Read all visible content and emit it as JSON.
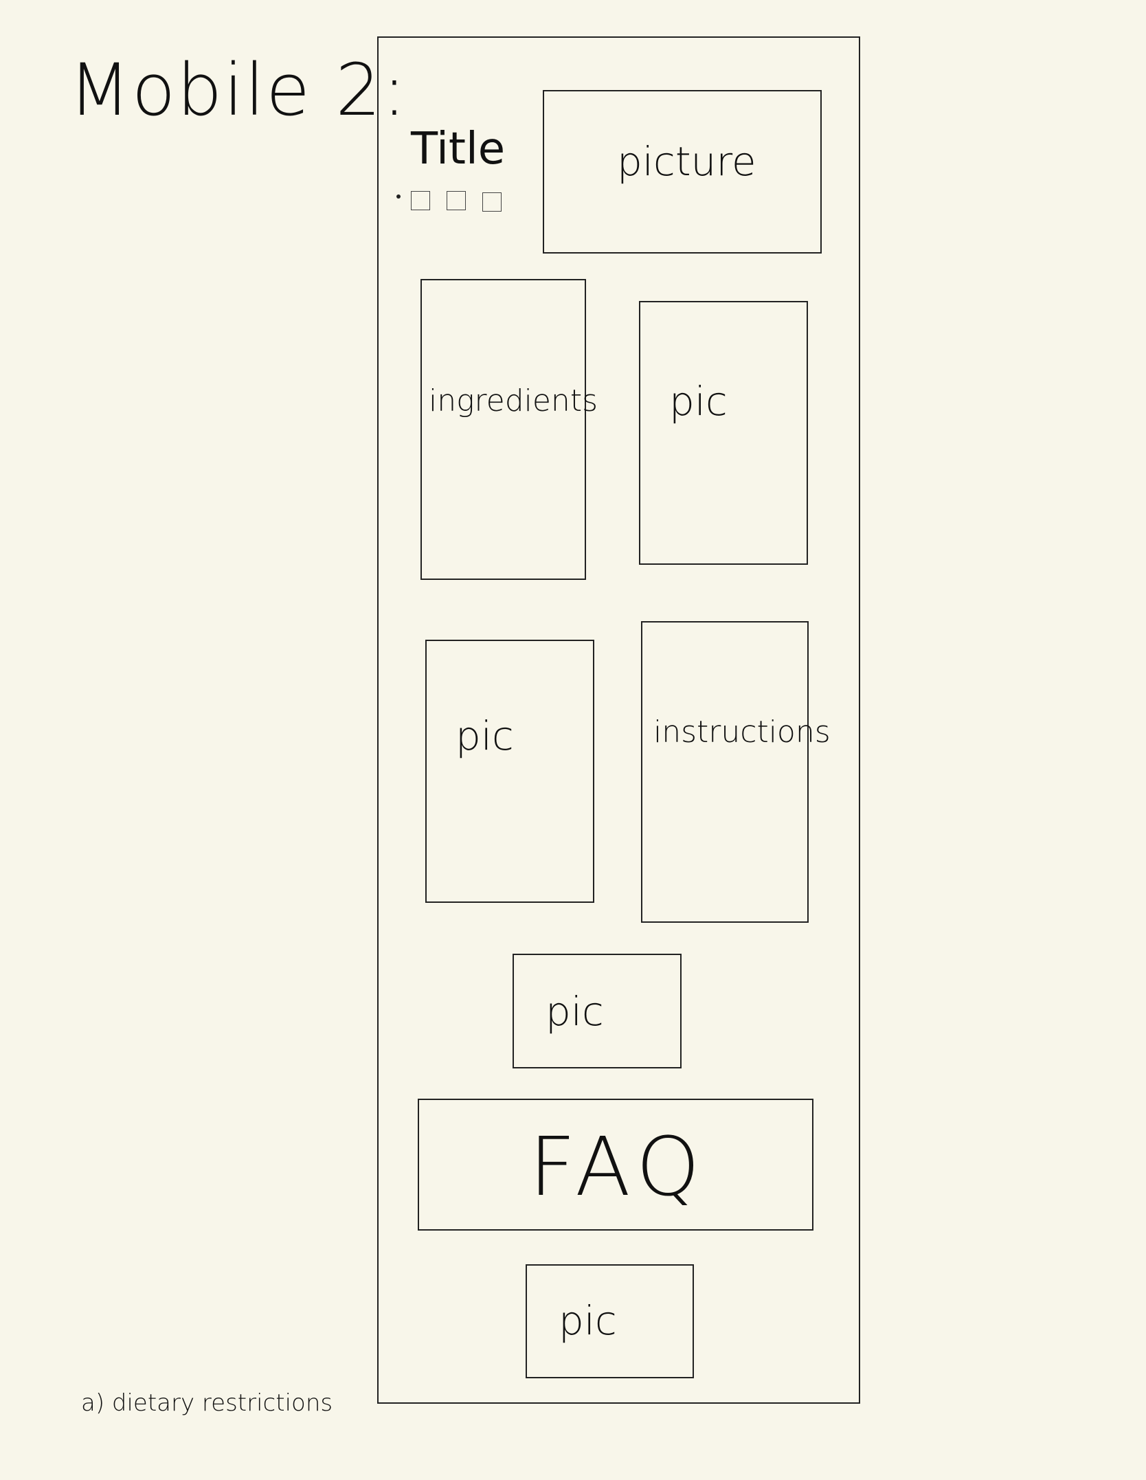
{
  "heading": "Mobile 2:",
  "title": "Title",
  "boxes": {
    "hero_picture": "picture",
    "ingredients": "ingredients",
    "pic_1": "pic",
    "pic_2": "pic",
    "instructions": "instructions",
    "pic_3": "pic",
    "faq": "FAQ",
    "pic_4": "pic"
  },
  "footnote": "a) dietary restrictions"
}
